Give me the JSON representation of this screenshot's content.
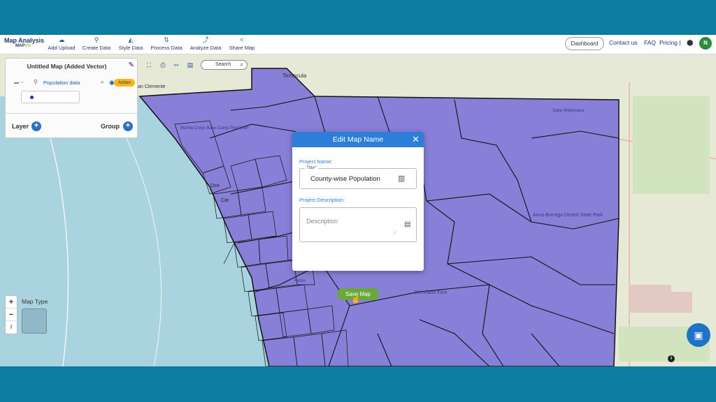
{
  "topbar": {
    "brand_title": "Map Analysis",
    "brand_sub_a": "MAP",
    "brand_sub_b": "VG",
    "nav": [
      {
        "label": "Add Upload",
        "icon": "cloud-upload-icon"
      },
      {
        "label": "Create Data",
        "icon": "location-pin-icon"
      },
      {
        "label": "Style Data",
        "icon": "paint-bucket-icon"
      },
      {
        "label": "Process Data",
        "icon": "process-icon"
      },
      {
        "label": "Analyze Data",
        "icon": "analyze-icon"
      },
      {
        "label": "Share Map",
        "icon": "share-icon"
      }
    ],
    "dashboard": "Dashboard",
    "contact": "Contact us",
    "faq": "FAQ",
    "pricing": "Pricing |",
    "avatar_letter": "N"
  },
  "layer_panel": {
    "title": "Untitled Map (Added Vector)",
    "layer_name": "Population data",
    "action_label": "Action",
    "layer_label": "Layer",
    "group_label": "Group"
  },
  "map_tools": {
    "search_label": "Search"
  },
  "map_labels": {
    "temecula": "Temecula",
    "ocean": "Oce",
    "carlsbad": "Car",
    "camp_pendleton": "Marine Corps Base Camp Pendleton",
    "san_clemente": "an Clemente",
    "anza": "Anza-Borrego Desert State Park",
    "cleveland": "Cleveland Fore",
    "state_wilderness": "State Wilderness",
    "ysidro": "Ysidro"
  },
  "map_type": {
    "label": "Map Type"
  },
  "modal": {
    "title": "Edit Map Name",
    "project_name_label": "Project Name:",
    "title_legend": "Title*",
    "title_value": "County-wise Population",
    "project_description_label": "Project Description:",
    "description_placeholder": "Description",
    "save_label": "Save Map"
  },
  "colors": {
    "overlay": "#7b6fd8",
    "modal_header": "#2c7ed8",
    "save_button": "#69a83a",
    "frame_bg": "#0b7ea0"
  }
}
